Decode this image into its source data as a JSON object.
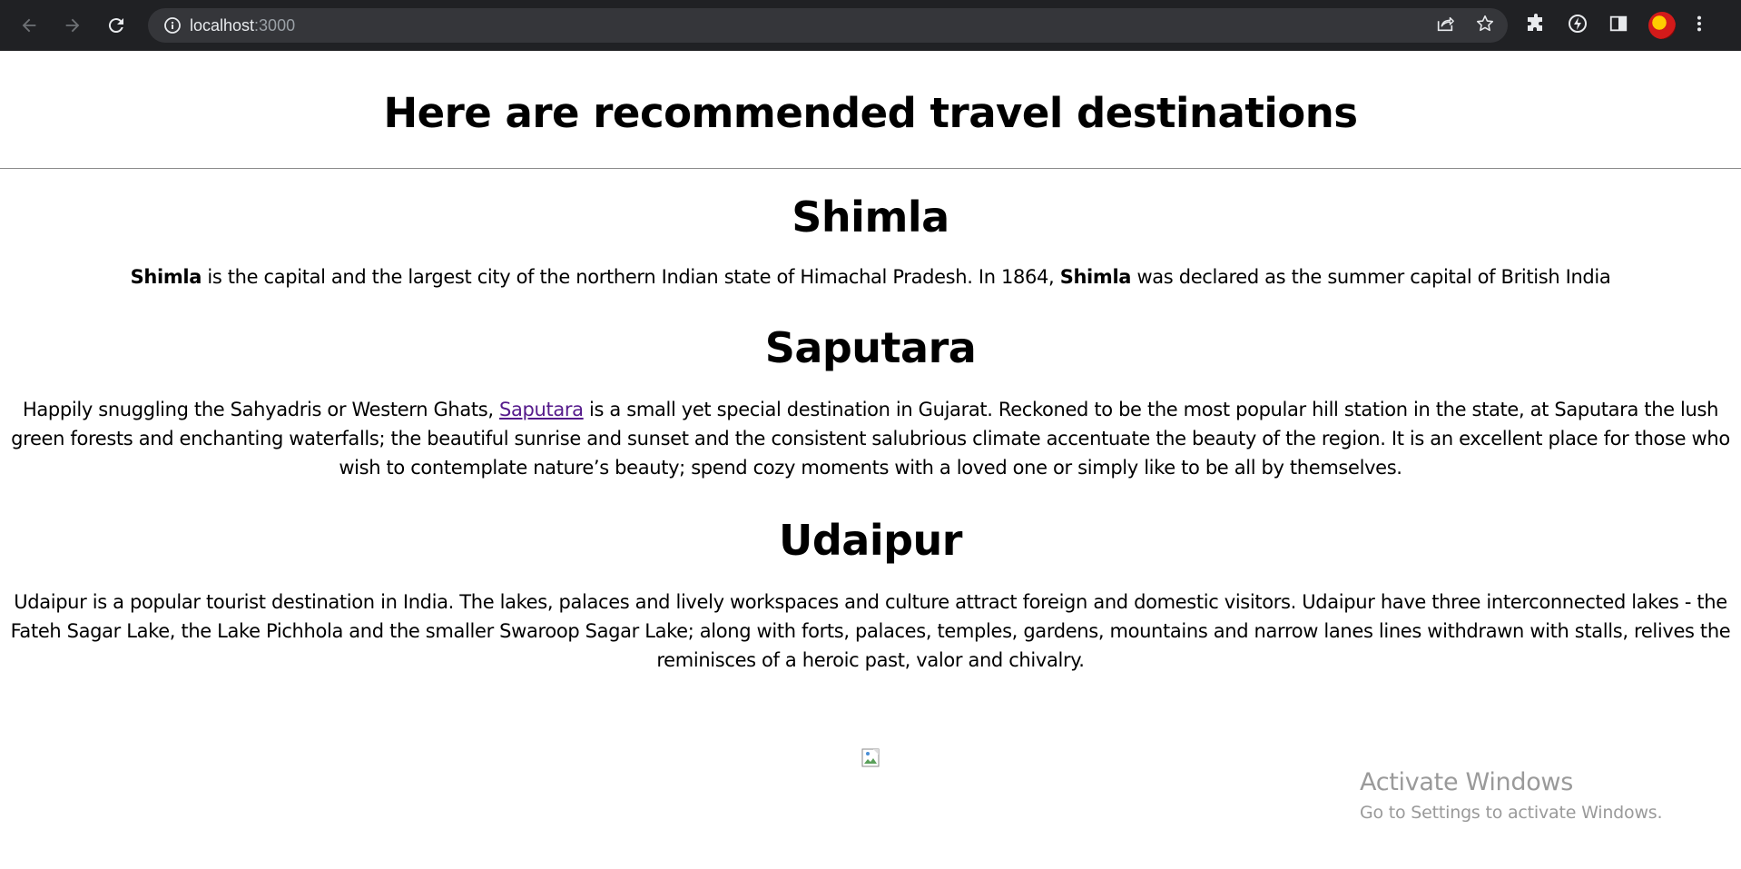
{
  "browser": {
    "url_host": "localhost",
    "url_port": ":3000",
    "icons": [
      "back-icon",
      "forward-icon",
      "reload-icon",
      "info-icon",
      "share-icon",
      "bookmark-star-icon",
      "extensions-icon",
      "extension-icon",
      "side-panel-icon",
      "profile-avatar",
      "menu-icon"
    ]
  },
  "page": {
    "title": "Here are recommended travel destinations",
    "destinations": [
      {
        "heading": "Shimla",
        "parts": {
          "b1": "Shimla",
          "t1": " is the capital and the largest city of the northern Indian state of Himachal Pradesh. In 1864, ",
          "b2": "Shimla",
          "t2": " was declared as the summer capital of British India"
        }
      },
      {
        "heading": "Saputara",
        "parts": {
          "t1": "Happily snuggling the Sahyadris or Western Ghats, ",
          "link": "Saputara",
          "t2": " is a small yet special destination in Gujarat. Reckoned to be the most popular hill station in the state, at Saputara the lush green forests and enchanting waterfalls; the beautiful sunrise and sunset and the consistent salubrious climate accentuate the beauty of the region. It is an excellent place for those who wish to contemplate nature’s beauty; spend cozy moments with a loved one or simply like to be all by themselves."
        }
      },
      {
        "heading": "Udaipur",
        "parts": {
          "t1": "Udaipur is a popular tourist destination in India. The lakes, palaces and lively workspaces and culture attract foreign and domestic visitors.  Udaipur have three interconnected lakes - the Fateh Sagar Lake, the Lake Pichhola and the smaller Swaroop Sagar Lake; along with forts, palaces, temples, gardens, mountains and narrow lanes lines withdrawn with stalls, relives the reminisces of a heroic past, valor and chivalry."
        }
      }
    ]
  },
  "watermark": {
    "line1": "Activate Windows",
    "line2": "Go to Settings to activate Windows."
  },
  "colors": {
    "toolbar": "#202124",
    "omnibox": "#35363a",
    "link_visited": "#551a8b"
  }
}
